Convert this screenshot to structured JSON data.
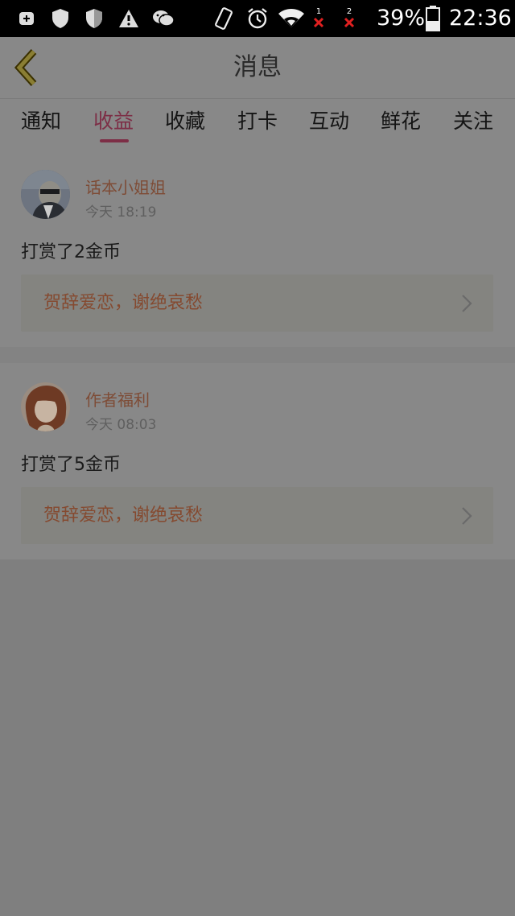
{
  "status_bar": {
    "battery_percent": "39%",
    "time": "22:36",
    "sim1_label": "1",
    "sim2_label": "2",
    "icons": [
      "app-plus-icon",
      "shield-icon",
      "shield-icon",
      "warning-icon",
      "wechat-icon",
      "rotate-icon",
      "alarm-icon",
      "wifi-icon",
      "no-signal-icon",
      "no-signal-icon",
      "battery-icon"
    ]
  },
  "header": {
    "title": "消息",
    "back_icon": "chevron-left-icon"
  },
  "tabs": [
    {
      "label": "通知"
    },
    {
      "label": "收益"
    },
    {
      "label": "收藏"
    },
    {
      "label": "打卡"
    },
    {
      "label": "互动"
    },
    {
      "label": "鲜花"
    },
    {
      "label": "关注"
    }
  ],
  "active_tab": "收益",
  "messages": [
    {
      "user": "话本小姐姐",
      "time": "今天 18:19",
      "content": "打赏了2金币",
      "book_title": "贺辞爱恋，谢绝哀愁"
    },
    {
      "user": "作者福利",
      "time": "今天 08:03",
      "content": "打赏了5金币",
      "book_title": "贺辞爱恋，谢绝哀愁"
    }
  ],
  "colors": {
    "accent": "#7d2e46",
    "username": "#7e4c36",
    "book_title": "#854a30",
    "overlay_bg": "#7f7f7f"
  }
}
